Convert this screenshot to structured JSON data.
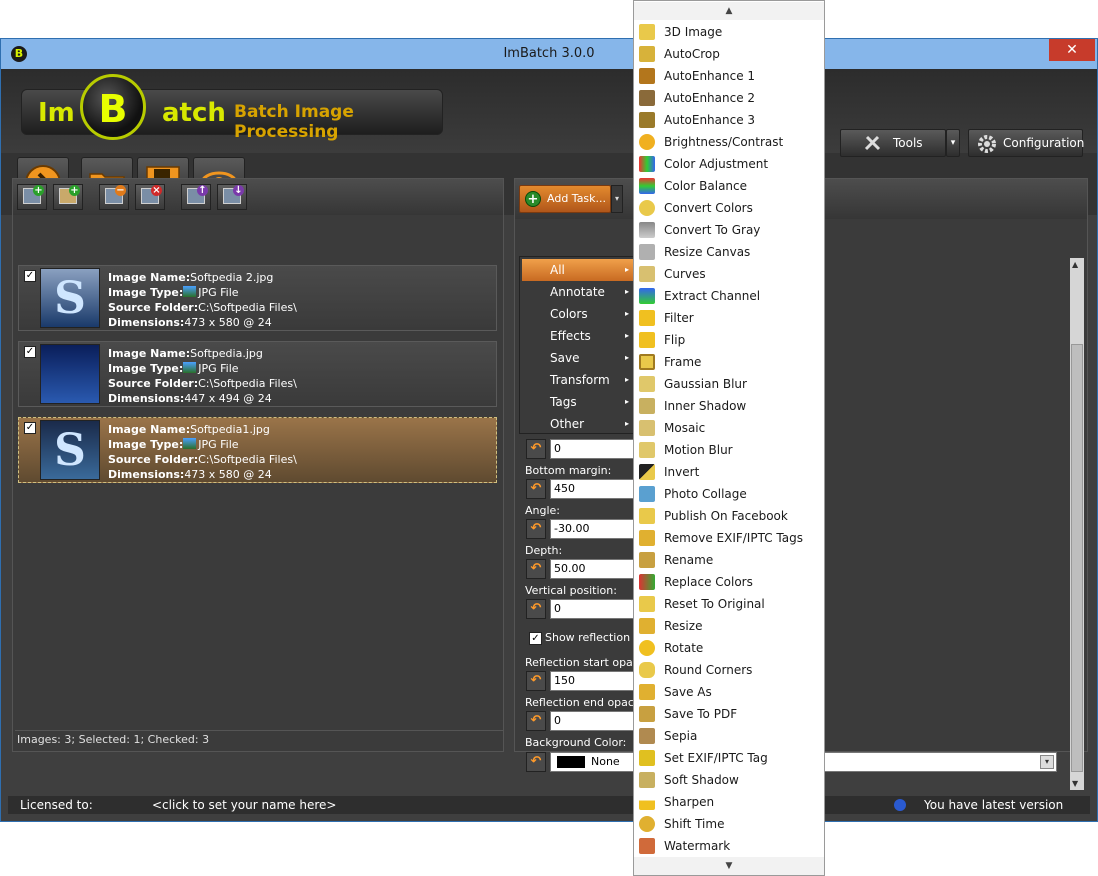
{
  "window": {
    "title": "ImBatch 3.0.0",
    "app_icon_letter": "B",
    "close_glyph": "✕"
  },
  "logo": {
    "left": "Im",
    "middle": "B",
    "right": "atch",
    "tagline": "Batch Image Processing"
  },
  "toolbar": {
    "tools_label": "Tools",
    "configuration_label": "Configuration",
    "dropdown_glyph": "▾"
  },
  "images": [
    {
      "name_label": "Image Name:",
      "name": "Softpedia 2.jpg",
      "type_label": "Image Type:",
      "type": "JPG File",
      "folder_label": "Source Folder:",
      "folder": "C:\\Softpedia Files\\",
      "dim_label": "Dimensions:",
      "dimensions": "473 x 580 @ 24",
      "checked": "✓",
      "thumb": "S"
    },
    {
      "name_label": "Image Name:",
      "name": "Softpedia.jpg",
      "type_label": "Image Type:",
      "type": "JPG File",
      "folder_label": "Source Folder:",
      "folder": "C:\\Softpedia Files\\",
      "dim_label": "Dimensions:",
      "dimensions": "447 x 494 @ 24",
      "checked": "✓",
      "thumb": ""
    },
    {
      "name_label": "Image Name:",
      "name": "Softpedia1.jpg",
      "type_label": "Image Type:",
      "type": "JPG File",
      "folder_label": "Source Folder:",
      "folder": "C:\\Softpedia Files\\",
      "dim_label": "Dimensions:",
      "dimensions": "473 x 580 @ 24",
      "checked": "✓",
      "thumb": "S"
    }
  ],
  "left_status": "Images: 3; Selected: 1; Checked: 3",
  "task_panel": {
    "add_task_label": "Add Task..."
  },
  "categories": [
    "All",
    "Annotate",
    "Colors",
    "Effects",
    "Save",
    "Transform",
    "Tags",
    "Other"
  ],
  "category_arrow": "▸",
  "props": {
    "first_value": "0",
    "bottom_margin_label": "Bottom margin:",
    "bottom_margin": "450",
    "angle_label": "Angle:",
    "angle": "-30.00",
    "depth_label": "Depth:",
    "depth": "50.00",
    "vertical_label": "Vertical position:",
    "vertical": "0",
    "show_reflection_label": "Show reflection",
    "show_reflection_check": "✓",
    "refl_start_label": "Reflection start opacit",
    "refl_start": "150",
    "refl_end_label": "Reflection end opacity",
    "refl_end": "0",
    "bg_color_label": "Background Color:",
    "bg_color": "None",
    "reset_glyph": "↶"
  },
  "status_bar": {
    "licensed_label": "Licensed to:",
    "licensed_value": "<click to set your name here>",
    "version_status": "You have latest version"
  },
  "task_menu": {
    "scroll_up": "▲",
    "scroll_down": "▼",
    "items": [
      "3D Image",
      "AutoCrop",
      "AutoEnhance 1",
      "AutoEnhance 2",
      "AutoEnhance 3",
      "Brightness/Contrast",
      "Color Adjustment",
      "Color Balance",
      "Convert Colors",
      "Convert To Gray",
      "Resize Canvas",
      "Curves",
      "Extract Channel",
      "Filter",
      "Flip",
      "Frame",
      "Gaussian Blur",
      "Inner Shadow",
      "Mosaic",
      "Motion Blur",
      "Invert",
      "Photo Collage",
      "Publish On Facebook",
      "Remove EXIF/IPTC Tags",
      "Rename",
      "Replace Colors",
      "Reset To Original",
      "Resize",
      "Rotate",
      "Round Corners",
      "Save As",
      "Save To PDF",
      "Sepia",
      "Set EXIF/IPTC Tag",
      "Soft Shadow",
      "Sharpen",
      "Shift Time",
      "Watermark"
    ]
  },
  "colors": {
    "accent": "#e38a2e",
    "title_bar": "#86b6ea",
    "close": "#c73b2b",
    "bg_dark": "#3f3f3f"
  }
}
